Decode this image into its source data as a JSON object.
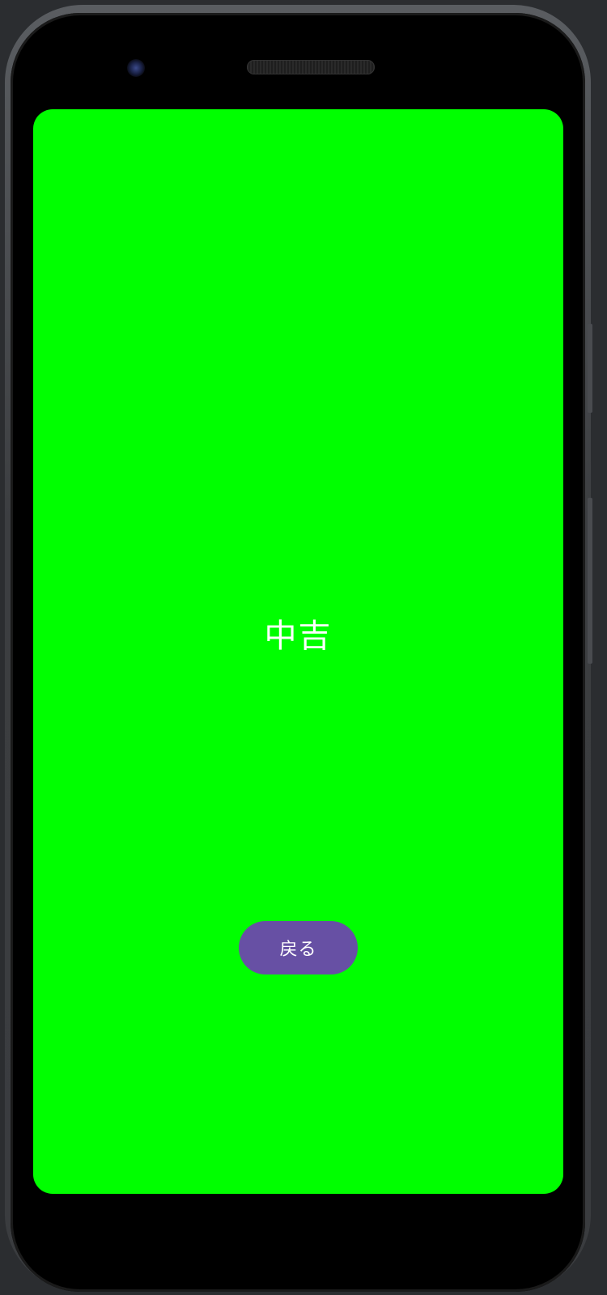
{
  "colors": {
    "screen_background": "#00ff00",
    "result_text": "#ffffff",
    "button_background": "#6750a4",
    "button_text": "#ffffff"
  },
  "screen": {
    "result_text": "中吉",
    "back_button_label": "戻る"
  }
}
